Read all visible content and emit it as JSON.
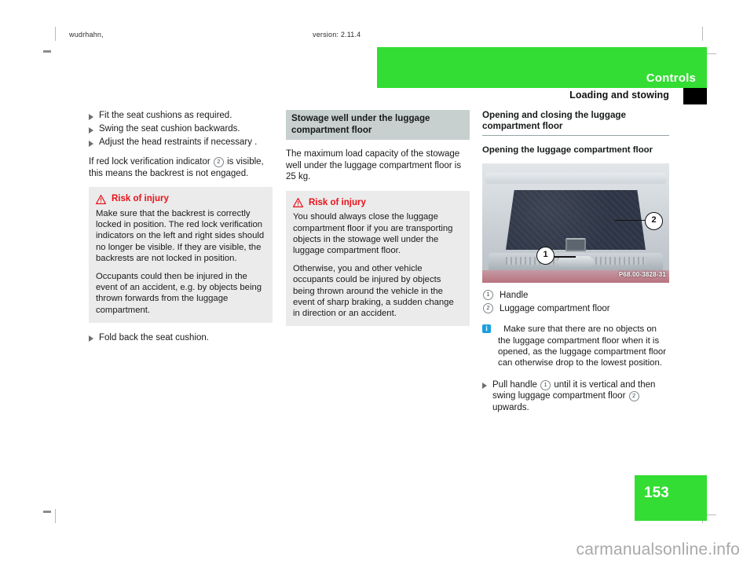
{
  "running_head": {
    "left": "wudrhahn,",
    "right": "version: 2.11.4"
  },
  "header": {
    "chapter": "Controls",
    "section": "Loading and stowing"
  },
  "column_left": {
    "steps": [
      "Fit the seat cushions as required.",
      "Swing the seat cushion backwards.",
      "Adjust the head restraints if necessary ."
    ],
    "paragraph_pre": "If red lock verification indicator",
    "paragraph_ref": "2",
    "paragraph_post": "is visible, this means the backrest is not engaged.",
    "warning": {
      "title": "Risk of injury",
      "paragraphs": [
        "Make sure that the backrest is correctly locked in position. The red lock verification indicators on the left and right sides should no longer be visible. If they are visible, the backrests are not locked in position.",
        "Occupants could then be injured in the event of an accident, e.g. by objects being thrown forwards from the luggage compartment."
      ]
    },
    "final_step": "Fold back the seat cushion."
  },
  "column_middle": {
    "heading": "Stowage well under the luggage compartment floor",
    "body": "The maximum load capacity of the stowage well under the luggage compartment floor is 25 kg.",
    "warning": {
      "title": "Risk of injury",
      "paragraphs": [
        "You should always close the luggage compartment floor if you are transporting objects in the stowage well under the luggage compartment floor.",
        "Otherwise, you and other vehicle occupants could be injured by objects being thrown around the vehicle in the event of sharp braking, a sudden change in direction or an accident."
      ]
    }
  },
  "column_right": {
    "heading": "Opening and closing the luggage compartment floor",
    "subheading": "Opening the luggage compartment floor",
    "figure": {
      "code": "P68.00-3828-31",
      "callouts": [
        "1",
        "2"
      ]
    },
    "legend": [
      {
        "ref": "1",
        "label": "Handle"
      },
      {
        "ref": "2",
        "label": "Luggage compartment floor"
      }
    ],
    "info_note": "Make sure that there are no objects on the luggage compartment floor when it is opened, as the luggage compartment floor can otherwise drop to the lowest position.",
    "step": {
      "pre": "Pull handle",
      "ref1": "1",
      "mid": "until it is vertical and then swing luggage compartment floor",
      "ref2": "2",
      "post": "upwards."
    }
  },
  "footer": {
    "page_number": "153",
    "watermark": "carmanualsonline.info"
  },
  "colors": {
    "accent_green": "#33dd33",
    "warning_red": "#e8121a",
    "info_blue": "#1a9fe0",
    "grey_heading_bg": "#c8cfcf",
    "warning_bg": "#ebebeb"
  }
}
